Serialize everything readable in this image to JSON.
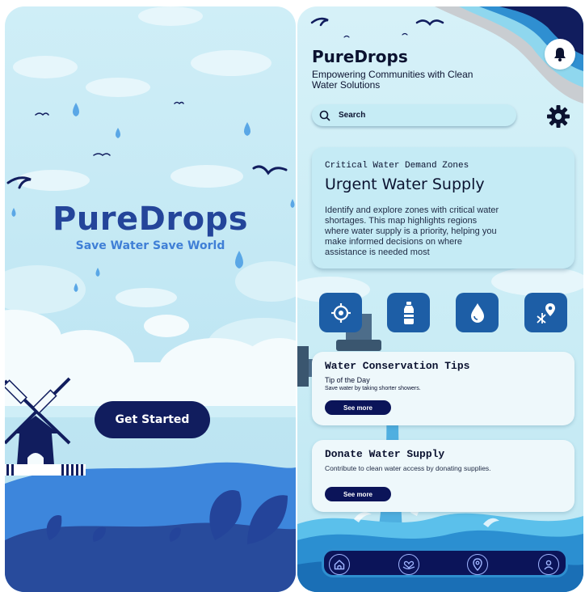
{
  "splash": {
    "title": "PureDrops",
    "tagline": "Save Water Save World",
    "get_started_label": "Get Started"
  },
  "home": {
    "app_title": "PureDrops",
    "app_subtitle": "Empowering Communities with Clean Water Solutions",
    "search_placeholder": "Search",
    "critical_card": {
      "eyebrow": "Critical Water Demand Zones",
      "title": "Urgent Water Supply",
      "body": "Identify and explore zones with critical water shortages. This map highlights regions where water supply is a priority, helping you make informed decisions on where assistance is needed most"
    },
    "quick_actions": [
      {
        "icon": "location-target-icon"
      },
      {
        "icon": "water-bottle-icon"
      },
      {
        "icon": "water-drop-icon"
      },
      {
        "icon": "map-pin-icon"
      }
    ],
    "tips_card": {
      "title": "Water Conservation Tips",
      "subtitle": "Tip of the Day",
      "tip": "Save water by taking shorter showers.",
      "button_label": "See more"
    },
    "donate_card": {
      "title": "Donate Water Supply",
      "body": "Contribute to clean water access by donating supplies.",
      "button_label": "See more"
    },
    "bottom_nav": [
      {
        "icon": "home-icon"
      },
      {
        "icon": "donate-heart-hand-icon"
      },
      {
        "icon": "location-pin-icon"
      },
      {
        "icon": "profile-icon"
      }
    ]
  },
  "colors": {
    "brand_navy": "#111d5e",
    "brand_blue": "#24459a",
    "action_blue": "#1d5ea6",
    "sky": "#cfeef7"
  }
}
